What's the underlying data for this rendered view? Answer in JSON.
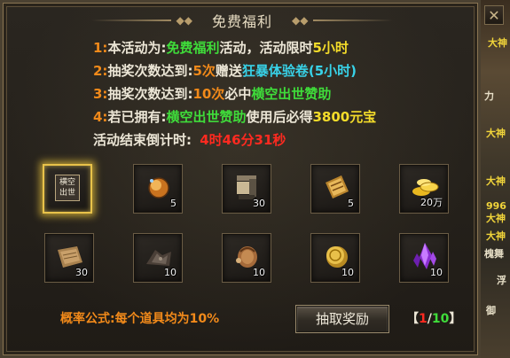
{
  "panel": {
    "title": "免费福利",
    "close_icon": "close-icon"
  },
  "info_lines": [
    {
      "num": "1:",
      "parts": [
        {
          "text": "本活动为:",
          "color": "white"
        },
        {
          "text": "免费福利",
          "color": "green"
        },
        {
          "text": "活动，活动限时",
          "color": "white"
        },
        {
          "text": "5小时",
          "color": "yellow"
        }
      ]
    },
    {
      "num": "2:",
      "parts": [
        {
          "text": "抽奖次数达到:",
          "color": "white"
        },
        {
          "text": "5次",
          "color": "orange"
        },
        {
          "text": "赠送",
          "color": "white"
        },
        {
          "text": "狂暴体验卷(5小时)",
          "color": "cyan"
        }
      ]
    },
    {
      "num": "3:",
      "parts": [
        {
          "text": "抽奖次数达到:",
          "color": "white"
        },
        {
          "text": "10次",
          "color": "orange"
        },
        {
          "text": "必中",
          "color": "white"
        },
        {
          "text": "横空出世赞助",
          "color": "green"
        }
      ]
    },
    {
      "num": "4:",
      "parts": [
        {
          "text": "若已拥有:",
          "color": "white"
        },
        {
          "text": "横空出世赞助",
          "color": "green"
        },
        {
          "text": "使用后必得",
          "color": "white"
        },
        {
          "text": "3800元宝",
          "color": "yellow"
        }
      ]
    }
  ],
  "countdown": {
    "label": "活动结束倒计时:",
    "value": "4时46分31秒"
  },
  "items": [
    {
      "icon": "sponsor-card-icon",
      "qty": "",
      "card_text_1": "横空",
      "card_text_2": "出世",
      "featured": true
    },
    {
      "icon": "orb-icon",
      "qty": "5"
    },
    {
      "icon": "scroll-stack-icon",
      "qty": "30"
    },
    {
      "icon": "golden-scroll-icon",
      "qty": "5"
    },
    {
      "icon": "gold-ingots-icon",
      "qty": "20万"
    },
    {
      "icon": "parchment-icon",
      "qty": "30"
    },
    {
      "icon": "dark-ore-icon",
      "qty": "10"
    },
    {
      "icon": "leather-pouch-icon",
      "qty": "10"
    },
    {
      "icon": "gold-coin-icon",
      "qty": "10"
    },
    {
      "icon": "purple-crystal-icon",
      "qty": "10"
    }
  ],
  "footer": {
    "formula": "概率公式:每个道具均为10%",
    "draw_button": "抽取奖励",
    "counter_open": "【",
    "counter_current": "1",
    "counter_sep": "/",
    "counter_total": "10",
    "counter_close": "】"
  },
  "scene": {
    "labels": [
      "大神",
      "力",
      "大神",
      "大神",
      "996",
      "大神",
      "大神",
      "槐舞",
      "浮",
      "御"
    ]
  },
  "colors": {
    "white": "#ece6d6",
    "green": "#3fdc3a",
    "orange": "#f28a1a",
    "cyan": "#38d2e8",
    "yellow": "#f4dc2a",
    "red": "#ff2a20"
  }
}
